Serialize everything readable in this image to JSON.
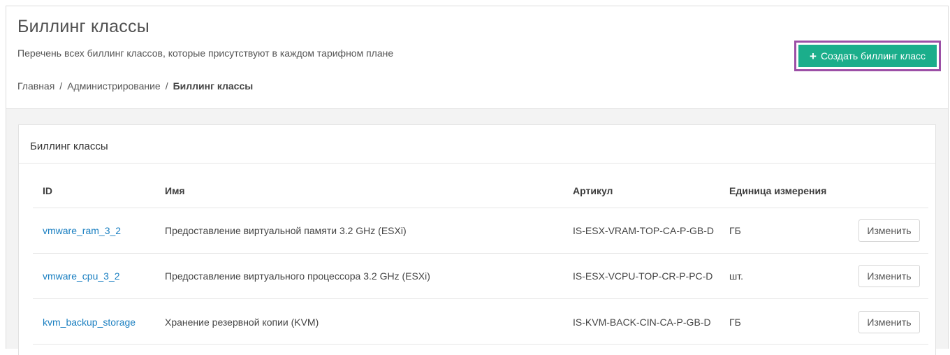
{
  "header": {
    "title": "Биллинг классы",
    "subtitle": "Перечень всех биллинг классов, которые присутствуют в каждом тарифном плане",
    "breadcrumb": [
      "Главная",
      "Администрирование",
      "Биллинг классы"
    ],
    "create_button_icon": "plus-icon",
    "create_button_label": "Создать биллинг класс"
  },
  "colors": {
    "accent": "#1bae8b",
    "highlight_border": "#9c4fa6",
    "link": "#1a7fc1"
  },
  "table": {
    "title": "Биллинг классы",
    "columns": [
      "ID",
      "Имя",
      "Артикул",
      "Единица измерения"
    ],
    "rows": [
      {
        "id": "vmware_ram_3_2",
        "name": "Предоставление виртуальной памяти 3.2 GHz (ESXi)",
        "article": "IS-ESX-VRAM-TOP-CA-P-GB-D",
        "unit": "ГБ",
        "action": "Изменить"
      },
      {
        "id": "vmware_cpu_3_2",
        "name": "Предоставление виртуального процессора 3.2 GHz (ESXi)",
        "article": "IS-ESX-VCPU-TOP-CR-P-PC-D",
        "unit": "шт.",
        "action": "Изменить"
      },
      {
        "id": "kvm_backup_storage",
        "name": "Хранение резервной копии (KVM)",
        "article": "IS-KVM-BACK-CIN-CA-P-GB-D",
        "unit": "ГБ",
        "action": "Изменить"
      }
    ]
  }
}
